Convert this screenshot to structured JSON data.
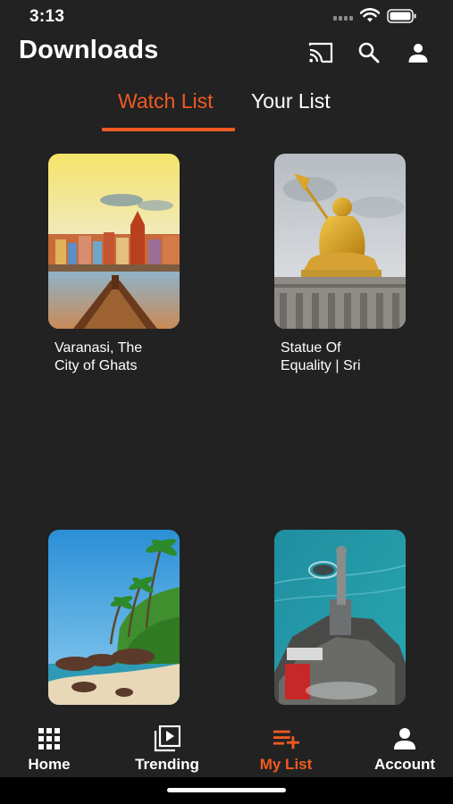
{
  "status_bar": {
    "time": "3:13"
  },
  "header": {
    "title": "Downloads",
    "icons": [
      "cast-icon",
      "search-icon",
      "profile-icon"
    ]
  },
  "tabs": [
    {
      "label": "Watch List",
      "active": true
    },
    {
      "label": "Your List",
      "active": false
    }
  ],
  "cards": [
    {
      "title": "Varanasi, The\nCity of Ghats"
    },
    {
      "title": "Statue Of\nEquality | Sri"
    },
    {
      "title": ""
    },
    {
      "title": ""
    }
  ],
  "bottom_nav": [
    {
      "label": "Home",
      "icon": "grid-icon",
      "active": false
    },
    {
      "label": "Trending",
      "icon": "play-library-icon",
      "active": false
    },
    {
      "label": "My List",
      "icon": "playlist-add-icon",
      "active": true
    },
    {
      "label": "Account",
      "icon": "person-icon",
      "active": false
    }
  ],
  "colors": {
    "background": "#222222",
    "accent": "#f05a22",
    "text": "#ffffff"
  }
}
